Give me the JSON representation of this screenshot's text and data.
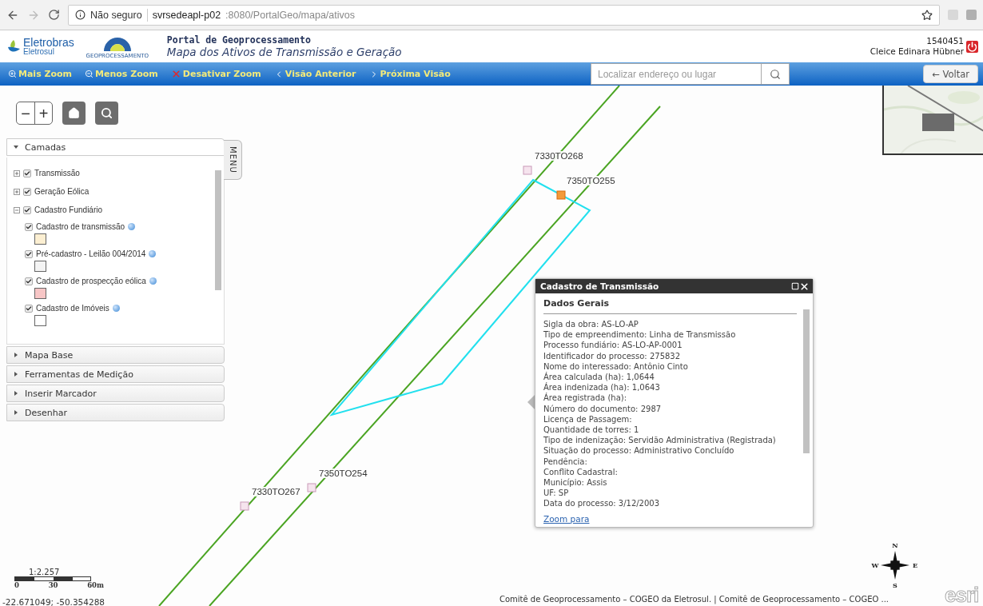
{
  "browser": {
    "security": "Não seguro",
    "url_host": "svrsedeapl-p02",
    "url_rest": ":8080/PortalGeo/mapa/ativos"
  },
  "header": {
    "brand": "Eletrobras",
    "subbrand": "Eletrosul",
    "logo_caption": "GEOPROCESSAMENTO",
    "title": "Portal de Geoprocessamento",
    "subtitle": "Mapa dos Ativos de Transmissão e Geração",
    "user_id": "1540451",
    "user_name": "Cleice Edinara Hübner"
  },
  "toolbar": {
    "tools": [
      {
        "label": "Mais Zoom",
        "kind": "zoom-in"
      },
      {
        "label": "Menos Zoom",
        "kind": "zoom-out"
      },
      {
        "label": "Desativar Zoom",
        "kind": "disable"
      },
      {
        "label": "Visão Anterior",
        "kind": "previous"
      },
      {
        "label": "Próxima Visão",
        "kind": "next"
      }
    ],
    "search": {
      "placeholder": "Localizar endereço ou lugar"
    },
    "back": "← Voltar"
  },
  "map_controls": {
    "zoom_out": "−",
    "zoom_in": "+"
  },
  "layers_panel": {
    "menu_tab": "MENU",
    "sections": [
      {
        "title": "Camadas",
        "expanded": true
      },
      {
        "title": "Mapa Base",
        "expanded": false
      },
      {
        "title": "Ferramentas de Medição",
        "expanded": false
      },
      {
        "title": "Inserir Marcador",
        "expanded": false
      },
      {
        "title": "Desenhar",
        "expanded": false
      }
    ],
    "layers": [
      {
        "label": "Transmissão",
        "checked": true,
        "expanded": false
      },
      {
        "label": "Geração Eólica",
        "checked": true,
        "expanded": false
      },
      {
        "label": "Cadastro Fundiário",
        "checked": true,
        "expanded": true,
        "children": [
          {
            "label": "Cadastro de transmissão",
            "checked": true,
            "color": "#fcefd2"
          },
          {
            "label": "Pré-cadastro - Leilão 004/2014",
            "checked": true,
            "color": "#f4f4f4"
          },
          {
            "label": "Cadastro de prospecção eólica",
            "checked": true,
            "color": "#f7c6c6"
          },
          {
            "label": "Cadastro de Imóveis",
            "checked": true,
            "color": "#ffffff"
          }
        ]
      }
    ]
  },
  "map": {
    "tower_labels": [
      {
        "label": "7330TO268",
        "highlighted": false
      },
      {
        "label": "7350TO255",
        "highlighted": true
      },
      {
        "label": "7350TO254",
        "highlighted": false
      },
      {
        "label": "7330TO267",
        "highlighted": false
      }
    ],
    "scale": "1:2.257",
    "scale_ticks": [
      "0",
      "30",
      "60m"
    ],
    "coordinates": "-22.671049; -50.354288",
    "compass": {
      "n": "N",
      "w": "W",
      "e": "E",
      "s": "S"
    },
    "attribution": "Comitê de Geoprocessamento – COGEO da Eletrosul. | Comitê de Geoprocessamento – COGEO ...",
    "esri": "esri"
  },
  "popup": {
    "title": "Cadastro de Transmissão",
    "section": "Dados Gerais",
    "lines": [
      "Sigla da obra: AS-LO-AP",
      "Tipo de empreendimento: Linha de Transmissão",
      "Processo fundiário: AS-LO-AP-0001",
      "Identificador do processo: 275832",
      "Nome do interessado: Antônio Cinto",
      "Área calculada (ha): 1,0644",
      "Área indenizada (ha): 1,0643",
      "Área registrada (ha):",
      "Número do documento: 2987",
      "Licença de Passagem:",
      "Quantidade de torres: 1",
      "Tipo de indenização: Servidão Administrativa (Registrada)",
      "Situação do processo: Administrativo Concluído",
      "Pendência:",
      "Conflito Cadastral:",
      "Município: Assis",
      "UF: SP",
      "Data do processo: 3/12/2003"
    ],
    "link": "Zoom para"
  }
}
